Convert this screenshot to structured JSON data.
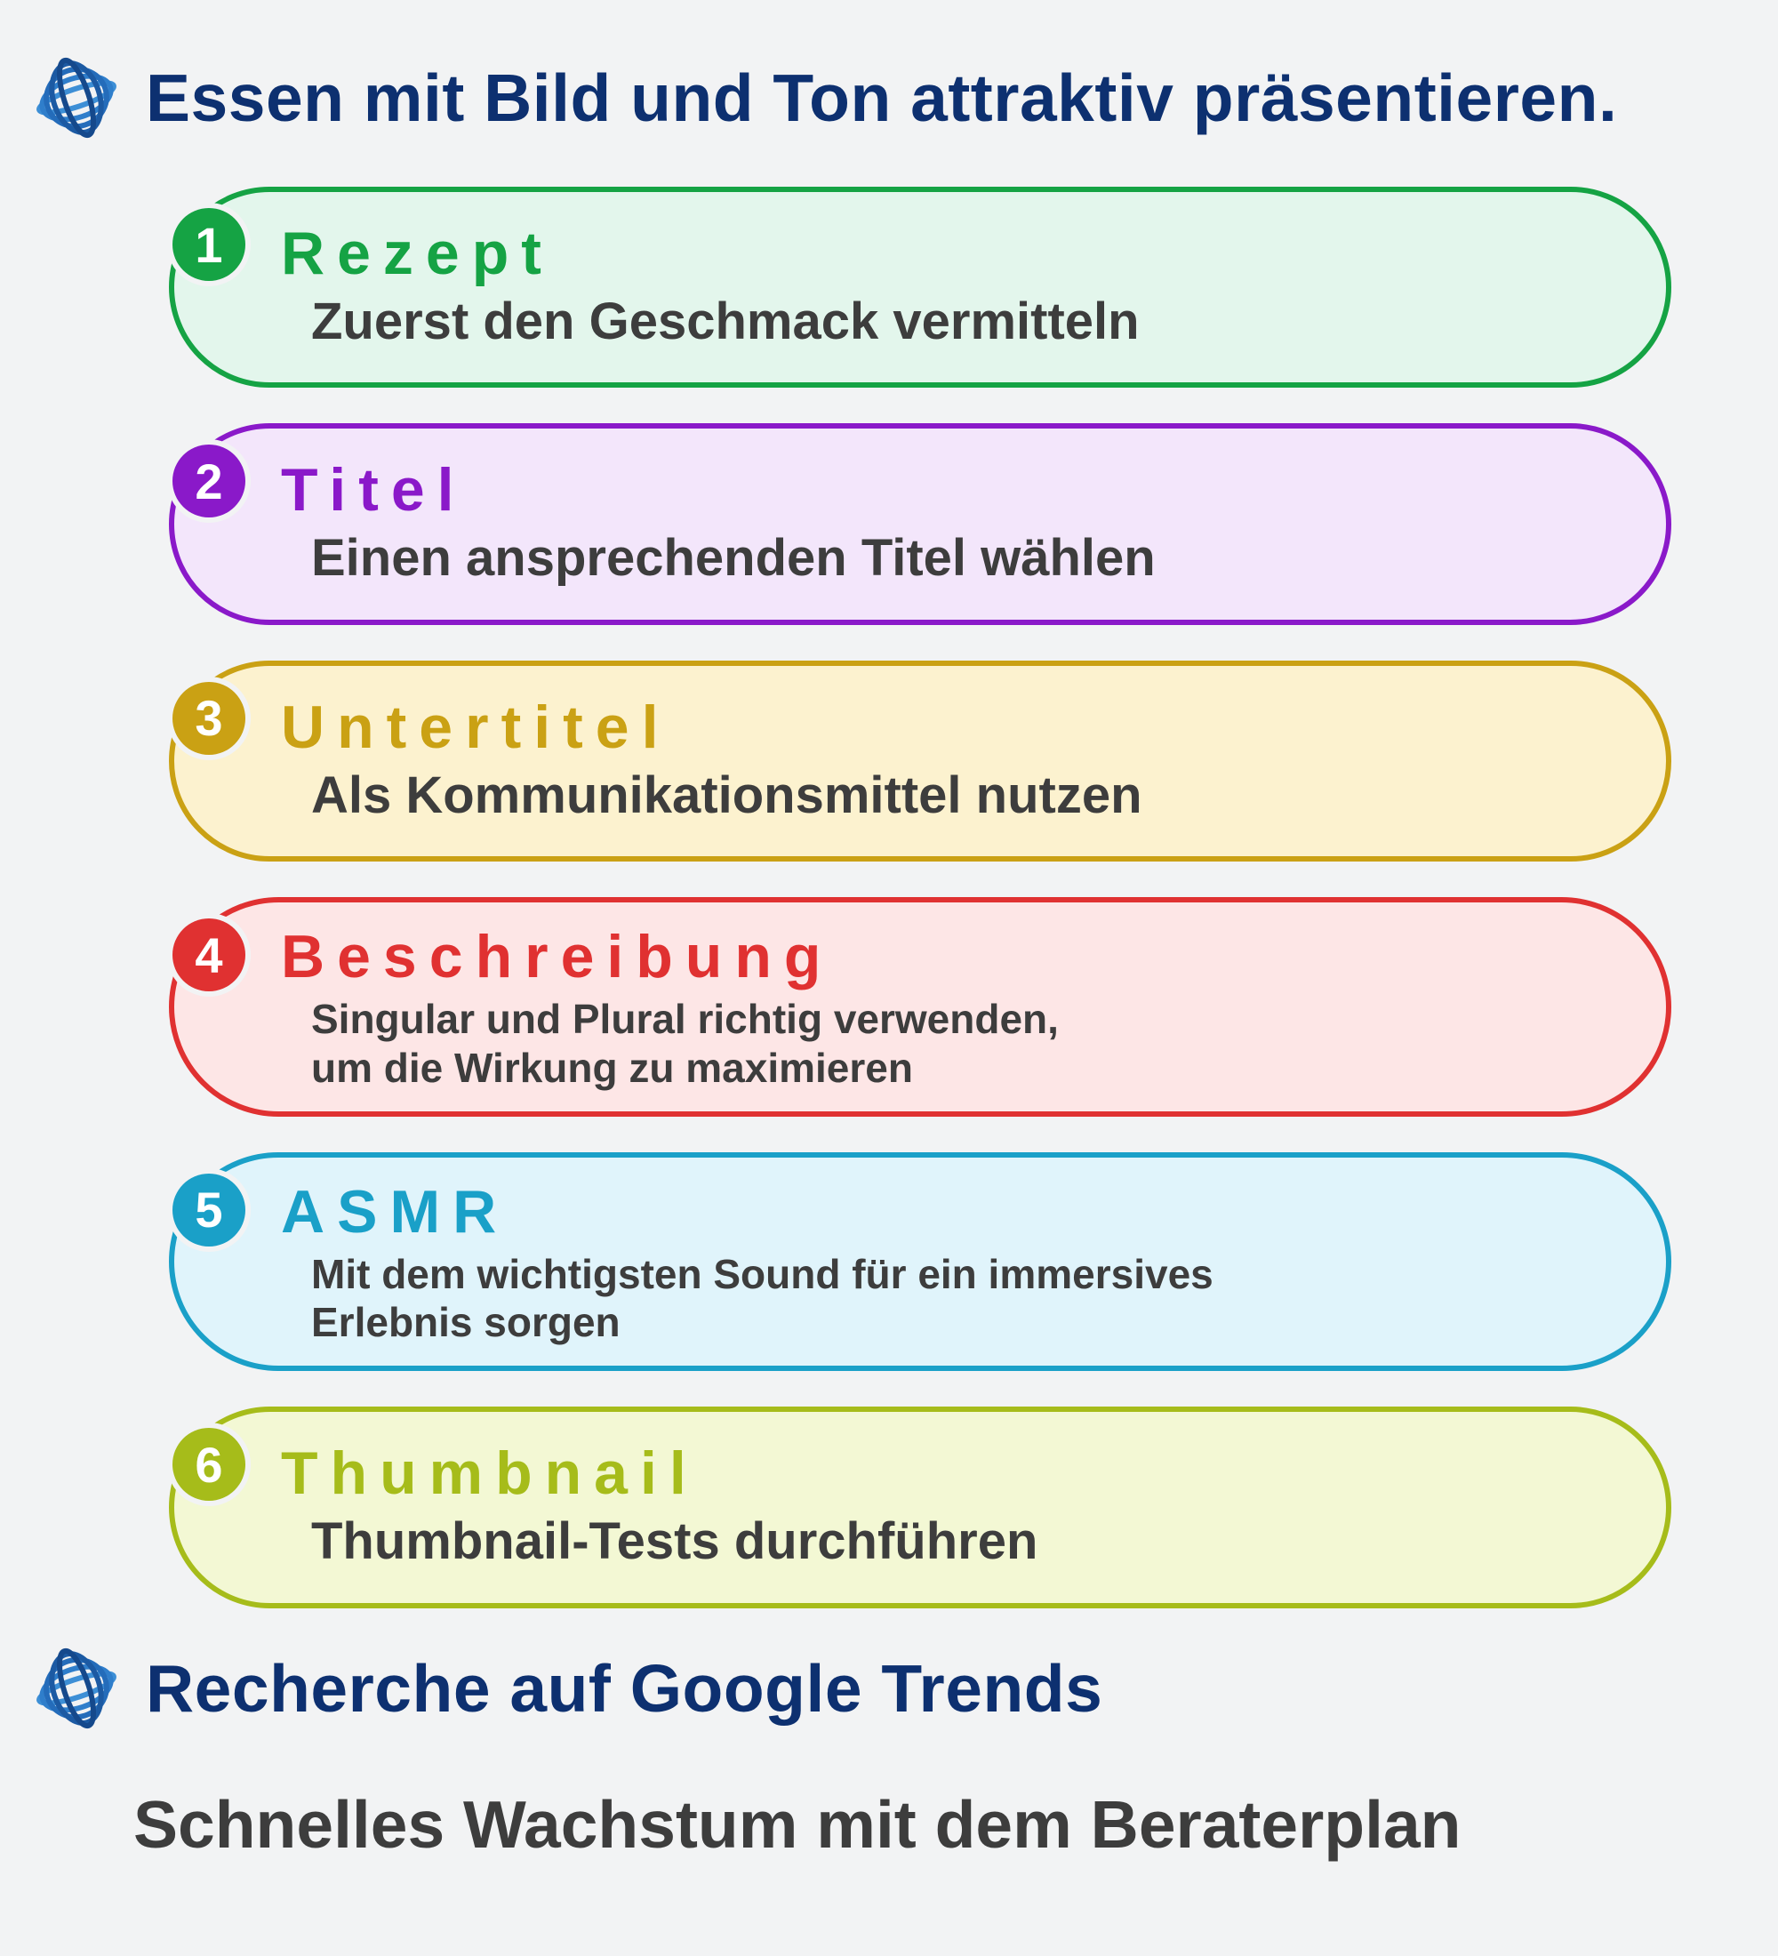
{
  "header1": "Essen mit Bild und Ton attraktiv präsentieren.",
  "header2": "Recherche auf Google Trends",
  "footer": "Schnelles Wachstum mit dem Beraterplan",
  "items": [
    {
      "num": "1",
      "label": "Rezept",
      "desc": "Zuerst den Geschmack vermitteln",
      "theme": "c-green",
      "small": false
    },
    {
      "num": "2",
      "label": "Titel",
      "desc": "Einen ansprechenden Titel wählen",
      "theme": "c-purple",
      "small": false
    },
    {
      "num": "3",
      "label": "Untertitel",
      "desc": "Als Kommunikationsmittel nutzen",
      "theme": "c-gold",
      "small": false
    },
    {
      "num": "4",
      "label": "Beschreibung",
      "desc": "Singular und Plural richtig verwenden,\num die Wirkung zu maximieren",
      "theme": "c-red",
      "small": true
    },
    {
      "num": "5",
      "label": "ASMR",
      "desc": "Mit dem wichtigsten Sound für ein immersives\nErlebnis sorgen",
      "theme": "c-cyan",
      "small": true
    },
    {
      "num": "6",
      "label": "Thumbnail",
      "desc": "Thumbnail-Tests durchführen",
      "theme": "c-olive",
      "small": false
    }
  ]
}
